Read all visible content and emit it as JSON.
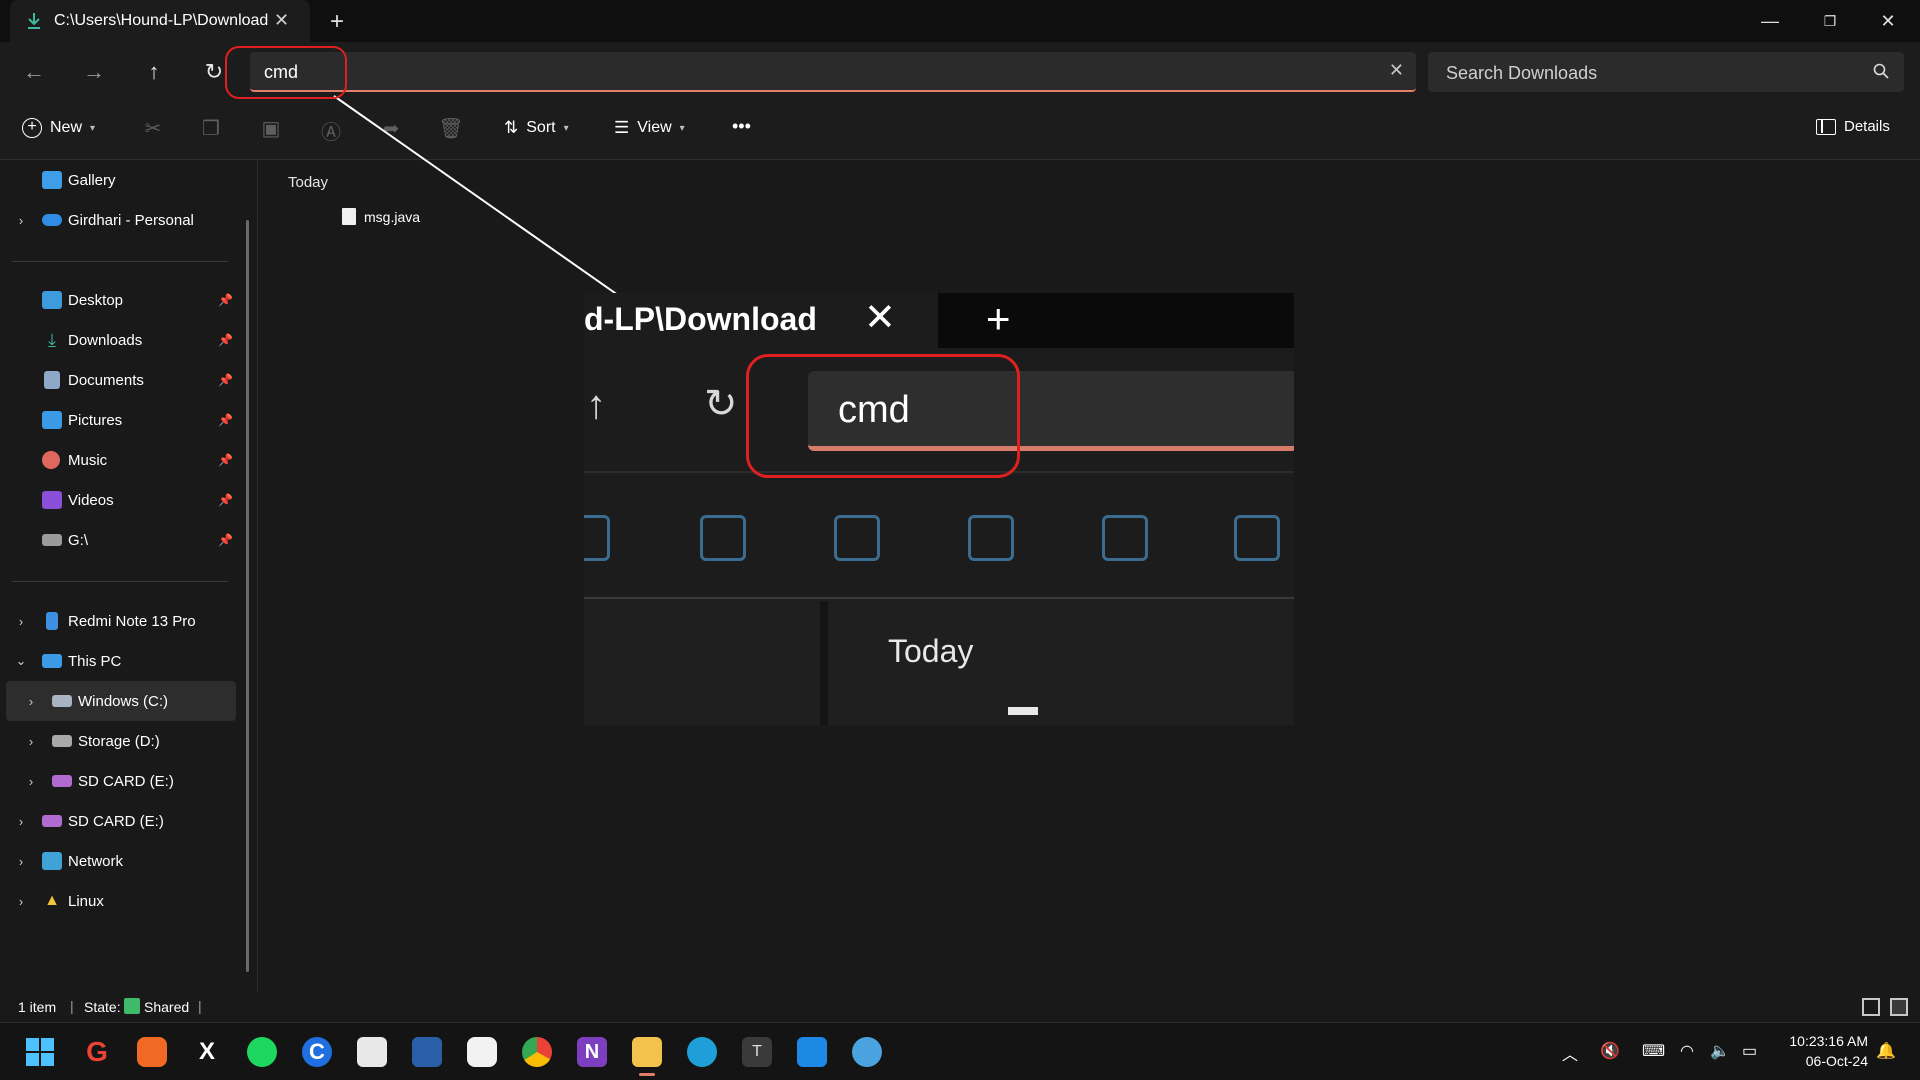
{
  "window": {
    "tab_title": "C:\\Users\\Hound-LP\\Download",
    "tab_close_icon": "close-icon",
    "new_tab_icon": "plus-icon"
  },
  "address_bar": {
    "value": "cmd",
    "search_placeholder": "Search Downloads"
  },
  "toolbar": {
    "new_label": "New",
    "sort_label": "Sort",
    "view_label": "View",
    "more_label": "•••",
    "details_label": "Details"
  },
  "sidebar": {
    "top_items": [
      {
        "label": "Gallery",
        "icon": "gallery-icon"
      },
      {
        "label": "Girdhari - Personal",
        "icon": "onedrive-icon"
      }
    ],
    "pinned": [
      {
        "label": "Desktop",
        "icon": "desktop-icon"
      },
      {
        "label": "Downloads",
        "icon": "downloads-icon"
      },
      {
        "label": "Documents",
        "icon": "documents-icon"
      },
      {
        "label": "Pictures",
        "icon": "pictures-icon"
      },
      {
        "label": "Music",
        "icon": "music-icon"
      },
      {
        "label": "Videos",
        "icon": "videos-icon"
      },
      {
        "label": "G:\\",
        "icon": "drive-icon"
      }
    ],
    "devices": [
      {
        "label": "Redmi Note 13 Pro",
        "icon": "phone-icon"
      },
      {
        "label": "This PC",
        "icon": "pc-icon"
      },
      {
        "label": "Windows (C:)",
        "icon": "drive-icon"
      },
      {
        "label": "Storage (D:)",
        "icon": "drive-icon"
      },
      {
        "label": "SD CARD (E:)",
        "icon": "sdcard-icon"
      },
      {
        "label": "SD CARD (E:)",
        "icon": "sdcard-icon"
      },
      {
        "label": "Network",
        "icon": "network-icon"
      },
      {
        "label": "Linux",
        "icon": "linux-icon"
      }
    ]
  },
  "content": {
    "group_header": "Today",
    "files": [
      {
        "name": "msg.java"
      }
    ]
  },
  "zoom_inset": {
    "tab_title": "d-LP\\Download",
    "address_value": "cmd",
    "group_header": "Today"
  },
  "status_bar": {
    "item_count": "1 item",
    "state_label": "State:",
    "state_value": "Shared"
  },
  "taskbar": {
    "time": "10:23:16 AM",
    "date": "06-Oct-24"
  },
  "colors": {
    "accent_underline": "#e37e6b",
    "annotation_red": "#e02020",
    "background": "#191919"
  }
}
